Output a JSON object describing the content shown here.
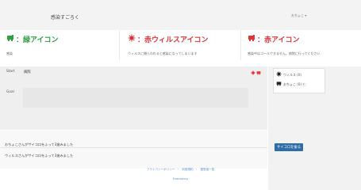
{
  "app": {
    "title": "感染すごろく",
    "user_name": "おちょこ ▾"
  },
  "legend": [
    {
      "icon": "virus-free-icon",
      "title": "：緑アイコン",
      "desc": "感染"
    },
    {
      "icon": "virus-icon",
      "title": "：赤ウィルスアイコン",
      "desc": "ウィルスに捕らわれると感染になってしまいます"
    },
    {
      "icon": "infected-icon",
      "title": "：赤アイコン",
      "desc": "感染中はゴールできません。病院に行ってください"
    }
  ],
  "board": {
    "start_label": "Start",
    "start_value": "病院",
    "goal_label": "Goal"
  },
  "players": [
    {
      "icon": "virus-icon",
      "label": "ウィルス (0)"
    },
    {
      "icon": "player-icon",
      "label": "おちょこ (0) 🐑"
    }
  ],
  "log": [
    "おちょこさんがサイコロをふって3進みました",
    "ウィルスさんがサイコロをふって3進みました"
  ],
  "actions": {
    "roll_label": "サイコロを振る"
  },
  "footer": {
    "links": [
      "プライバシーポリシー",
      "利用規約",
      "運営者一覧"
    ],
    "credit": "Enamotory"
  },
  "colors": {
    "green": "#2f9e45",
    "red": "#e0353a",
    "primary_button": "#2f6da9",
    "link": "#5b8dcf"
  }
}
